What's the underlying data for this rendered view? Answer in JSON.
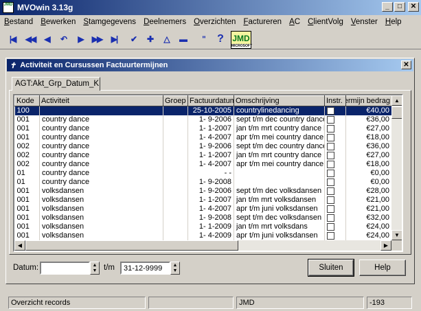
{
  "app": {
    "title": "MVOwin 3.13g",
    "icon_text": "JMD"
  },
  "window_controls": {
    "minimize": "_",
    "maximize": "□",
    "close": "✕"
  },
  "menu": [
    "Bestand",
    "Bewerken",
    "Stamgegevens",
    "Deelnemers",
    "Overzichten",
    "Factureren",
    "AC",
    "ClientVolg",
    "Venster",
    "Help"
  ],
  "toolbar": {
    "icons": [
      "first-record-icon",
      "previous-page-icon",
      "previous-record-icon",
      "undo-icon",
      "next-record-icon",
      "next-page-icon",
      "last-record-icon",
      "confirm-icon",
      "add-icon",
      "delete-icon",
      "cancel-icon",
      "quote-icon",
      "help-icon"
    ],
    "logo_text": "JMD",
    "logo_subtext": "MICROSOFT"
  },
  "child_window": {
    "title": "Activiteit en Cursussen Factuurtermijnen",
    "tab": "AGT:Akt_Grp_Datum_K"
  },
  "grid": {
    "columns": [
      "Kode",
      "Activiteit",
      "Groep",
      "Factuurdatum",
      "Omschrijving",
      "Instr.",
      "Termijn bedrag"
    ],
    "rows": [
      [
        "100",
        "",
        "",
        "25-10-2005",
        "countrylinedancing",
        "",
        "€40,00"
      ],
      [
        "001",
        "country dance",
        "",
        "1- 9-2006",
        "sept t/m dec country dance",
        "",
        "€36,00"
      ],
      [
        "001",
        "country dance",
        "",
        "1- 1-2007",
        "jan t/m mrt country dance b",
        "",
        "€27,00"
      ],
      [
        "001",
        "country dance",
        "",
        "1- 4-2007",
        "apr t/m mei country dance",
        "",
        "€18,00"
      ],
      [
        "002",
        "country dance",
        "",
        "1- 9-2006",
        "sept t/m dec country dance",
        "",
        "€36,00"
      ],
      [
        "002",
        "country dance",
        "",
        "1- 1-2007",
        "jan t/m mrt country dance",
        "",
        "€27,00"
      ],
      [
        "002",
        "country dance",
        "",
        "1- 4-2007",
        "apr t/m mei country dance",
        "",
        "€18,00"
      ],
      [
        "01",
        "country dance",
        "",
        "- -",
        "",
        "",
        "€0,00"
      ],
      [
        "01",
        "country dance",
        "",
        "1- 9-2008",
        "",
        "",
        "€0,00"
      ],
      [
        "001",
        "volksdansen",
        "",
        "1- 9-2006",
        "sept t/m dec volksdansen",
        "",
        "€28,00"
      ],
      [
        "001",
        "volksdansen",
        "",
        "1- 1-2007",
        "jan t/m mrt volksdansen",
        "",
        "€21,00"
      ],
      [
        "001",
        "volksdansen",
        "",
        "1- 4-2007",
        "apr t/m juni volksdansen",
        "",
        "€21,00"
      ],
      [
        "001",
        "volksdansen",
        "",
        "1- 9-2008",
        "sept t/m dec volksdansen",
        "",
        "€32,00"
      ],
      [
        "001",
        "volksdansen",
        "",
        "1- 1-2009",
        "jan t/m mrt volksdans",
        "",
        "€24,00"
      ],
      [
        "001",
        "volksdansen",
        "",
        "1- 4-2009",
        "apr t/m juni volksdansen",
        "",
        "€24,00"
      ]
    ]
  },
  "filter": {
    "datum_label": "Datum:",
    "datum_from": "",
    "tm_label": "t/m",
    "datum_to": "31-12-9999"
  },
  "buttons": {
    "close": "Sluiten",
    "help": "Help"
  },
  "statusbar": [
    "Overzicht records",
    "",
    "JMD",
    "-193"
  ]
}
